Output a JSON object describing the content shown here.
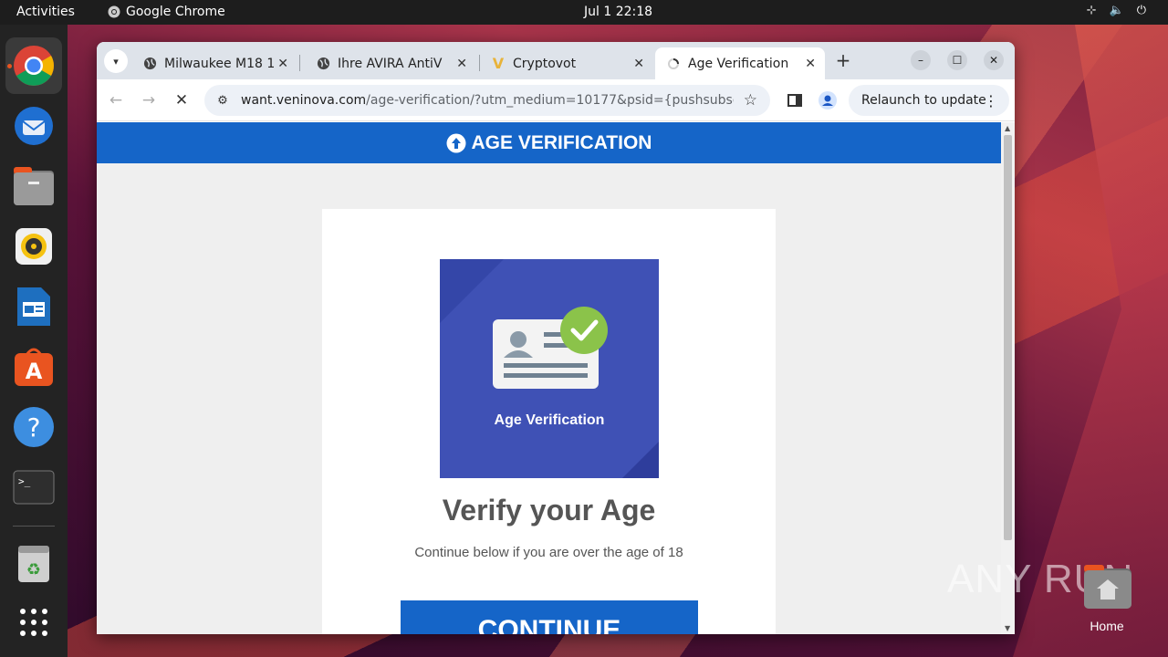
{
  "topbar": {
    "activities": "Activities",
    "app_name": "Google Chrome",
    "clock": "Jul 1  22:18"
  },
  "tabs": [
    {
      "title": "Milwaukee M18 1",
      "favicon": "globe-icon",
      "active": false
    },
    {
      "title": "Ihre AVIRA AntiV",
      "favicon": "globe-icon",
      "active": false
    },
    {
      "title": "Cryptovot",
      "favicon": "v-logo-icon",
      "active": false
    },
    {
      "title": "Age Verification",
      "favicon": "loading-icon",
      "active": true
    }
  ],
  "toolbar": {
    "url_host": "want.veninova.com",
    "url_path": "/age-verification/?utm_medium=10177&psid={pushsubscription...",
    "relaunch_label": "Relaunch to update"
  },
  "page": {
    "header_title": "AGE VERIFICATION",
    "hero_label": "Age Verification",
    "title": "Verify your Age",
    "subtitle": "Continue below if you are over the age of 18",
    "continue_label": "CONTINUE"
  },
  "desktop": {
    "watermark": "ANY RUN",
    "home_label": "Home"
  },
  "colors": {
    "brand_blue": "#1565c8",
    "hero_indigo": "#3f51b5",
    "check_green": "#8bc34a"
  }
}
